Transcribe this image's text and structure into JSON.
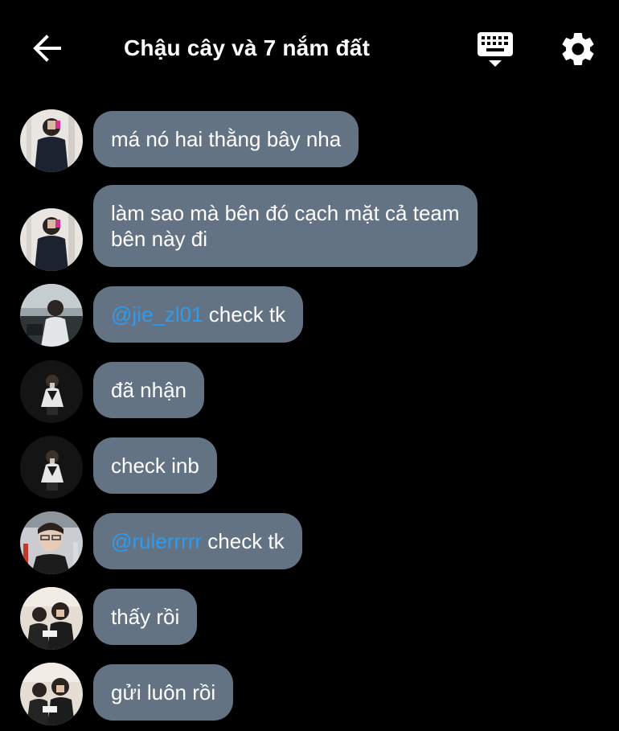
{
  "header": {
    "title": "Chậu cây và 7 nắm đất",
    "back_icon": "arrow-left-icon",
    "keyboard_icon": "keyboard-icon",
    "settings_icon": "gear-icon"
  },
  "messages": [
    {
      "text": "má nó hai thằng bây nha"
    },
    {
      "line1": "làm sao mà bên đó cạch mặt cả team",
      "line2": "bên này đi"
    },
    {
      "mention": "@jie_zl01",
      "text": " check tk"
    },
    {
      "text": "đã nhận"
    },
    {
      "text": "check inb"
    },
    {
      "mention": "@rulerrrrr",
      "text": " check tk"
    },
    {
      "text": "thấy rồi"
    },
    {
      "text": "gửi luôn rồi"
    }
  ],
  "colors": {
    "background": "#000000",
    "bubble": "#637384",
    "mention": "#2f9bf0"
  }
}
